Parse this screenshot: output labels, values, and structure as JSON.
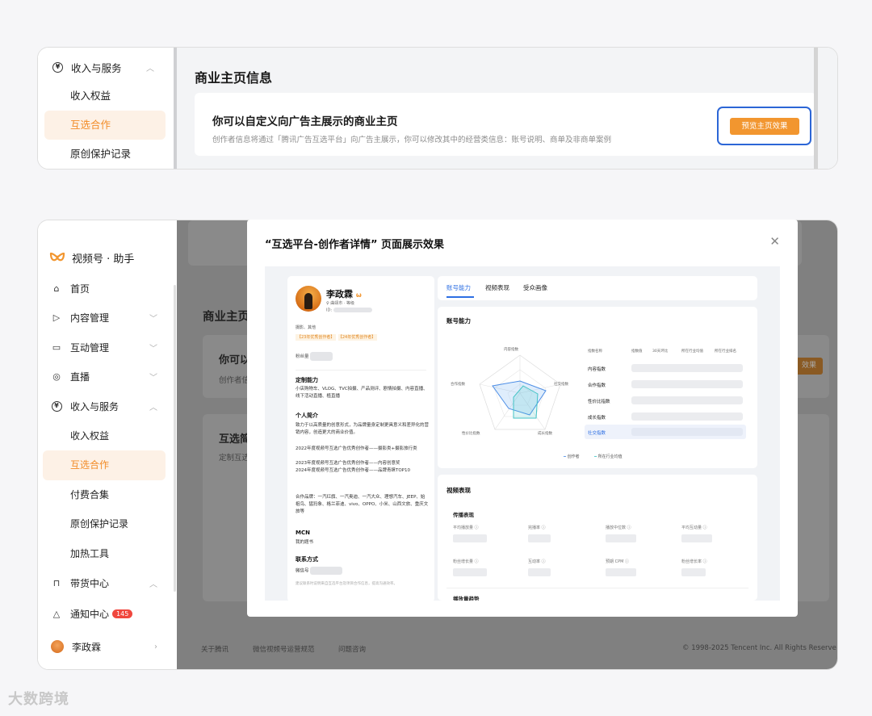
{
  "panel1": {
    "sidebar": {
      "group_label": "收入与服务",
      "items": [
        "收入权益",
        "互选合作",
        "原创保护记录"
      ]
    },
    "title": "商业主页信息",
    "card_title": "你可以自定义向广告主展示的商业主页",
    "card_desc": "创作者信息将通过「腾讯广告互选平台」向广告主展示，你可以修改其中的经营类信息：账号说明、商单及非商单案例",
    "preview_button": "预览主页效果"
  },
  "panel2": {
    "brand": "视频号 · 助手",
    "nav": {
      "home": "首页",
      "content": "内容管理",
      "interaction": "互动管理",
      "live": "直播",
      "income": "收入与服务",
      "income_items": [
        "收入权益",
        "互选合作",
        "付费合集",
        "原创保护记录",
        "加热工具"
      ],
      "commerce": "带货中心",
      "notifications": "通知中心",
      "notif_count": "145",
      "user": "李政霖"
    },
    "background": {
      "title": "商业主页",
      "card1_title": "你可以",
      "card1_desc": "创作者信",
      "card1_button": "效果",
      "card2_title": "互选简",
      "card2_desc": "定制互选",
      "footer_about": "关于腾讯",
      "footer_rules": "微信视频号运营规范",
      "footer_help": "问题咨询",
      "footer_copy": "© 1998-2025 Tencent Inc. All Rights Reserve"
    },
    "modal": {
      "title": "“互选平台-创作者详情” 页面展示效果",
      "profile": {
        "name": "李政霖",
        "meta": "♀ 曲靖市 · 等级",
        "id_label": "ID:",
        "category": "摄影、其他",
        "tags": [
          "【23年优秀创作者】",
          "【24年优秀创作者】"
        ],
        "fans_label": "粉丝量",
        "ability_title": "定制能力",
        "ability_text": "小店购物车、VLOG、TVC拍摄、产品测评、剧情拍摄、内容直播、线下活动直播、植直播",
        "intro_title": "个人简介",
        "intro_text": "致力于以高质量的创意形式，为品牌量身定制更具意义和差异化的营销内容，创造更大的商业价值。",
        "awards": [
          "2022年度视频号互选广告优秀创作者——摄影类+摄影旅行类",
          "2023年度视频号互选广告优秀创作者——内容创意奖",
          "2024年度视频号互选广告优秀创作者——品牌青睐TOP10"
        ],
        "brands_text": "合作品牌：一汽红旗、一汽奥迪、一汽大众、理想汽车、JEEP、始祖鸟、猛犸象、格兰菲迪、vivo、OPPO、小米、山西文旅、重庆文旅等",
        "mcn_title": "MCN",
        "mcn_value": "我的题书",
        "contact_title": "联系方式",
        "contact_label": "微信号",
        "contact_note": "建议联系时说明来自互选平台及项目合作信息，提高沟通效率。"
      },
      "tabs": [
        "账号能力",
        "视频表现",
        "受众画像"
      ],
      "capability": {
        "title": "账号能力",
        "radar_labels": [
          "内容指数",
          "社交指数",
          "成长指数",
          "性价比指数",
          "合作指数"
        ],
        "table_headers": [
          "指数名称",
          "指数值",
          "30天环比",
          "所在行业均值",
          "所在行业排名"
        ],
        "rows": [
          "内容指数",
          "合作指数",
          "性价比指数",
          "成长指数",
          "社交指数"
        ],
        "legend": [
          "创作者",
          "所在行业均值"
        ]
      },
      "video": {
        "title": "视频表现",
        "sub": "传播表现",
        "metrics": [
          "平均播放量",
          "完播率",
          "播放中位数",
          "平均互动量",
          "粉丝增长量",
          "互动率",
          "预期 CPM",
          "粉丝增长率"
        ],
        "trend": "播放量趋势"
      }
    }
  },
  "colors": {
    "accent": "#f2962f",
    "active_bg": "#fdf1e6",
    "active_text": "#f28c28",
    "highlight_frame": "#2c66d6",
    "tab_active": "#2d6fe3"
  },
  "watermark": "大数跨境"
}
